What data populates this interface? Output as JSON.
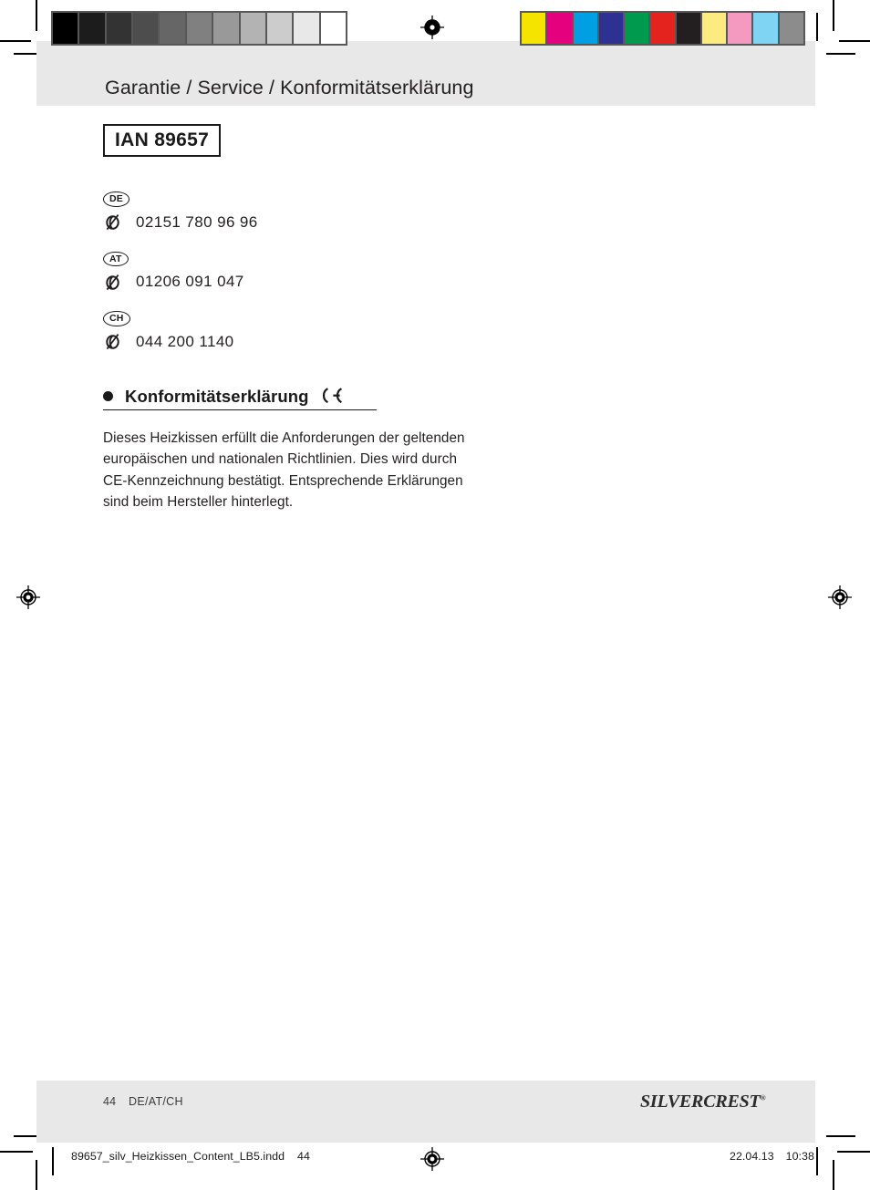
{
  "document": {
    "header_title": "Garantie / Service / Konformitätserklärung",
    "ian_label": "IAN 89657"
  },
  "service": {
    "entries": [
      {
        "country_code": "DE",
        "phone": "02151 780 96 96",
        "phone_icon": "phone-icon"
      },
      {
        "country_code": "AT",
        "phone": "01206 091 047",
        "phone_icon": "phone-icon"
      },
      {
        "country_code": "CH",
        "phone": "044 200 1140",
        "phone_icon": "phone-icon"
      }
    ]
  },
  "conformity": {
    "bullet_icon": "bullet-dot-icon",
    "heading": "Konformitätserklärung",
    "ce_icon": "ce-mark-icon",
    "body": "Dieses Heizkissen erfüllt die Anforderungen der geltenden europäischen und nationalen Richtlinien. Dies wird durch CE-Kennzeichnung bestätigt. Entsprechende Erklärungen sind beim Hersteller hinterlegt."
  },
  "footer": {
    "page_number": "44",
    "locales": "DE/AT/CH",
    "brand_silver": "SILVER",
    "brand_crest": "CREST",
    "brand_registered": "®"
  },
  "print_slug": {
    "filename": "89657_silv_Heizkissen_Content_LB5.indd",
    "page": "44",
    "date": "22.04.13",
    "time": "10:38"
  },
  "calibration": {
    "gray_wedge_label": "grayscale-step-wedge",
    "gray_steps": [
      "#000000",
      "#1c1c1c",
      "#333333",
      "#4d4d4d",
      "#666666",
      "#808080",
      "#999999",
      "#b3b3b3",
      "#cccccc",
      "#e8e8e8",
      "#ffffff"
    ],
    "color_bar_label": "color-control-bar",
    "color_steps": [
      "#f5e400",
      "#e5007e",
      "#009fe3",
      "#2e3192",
      "#009a4e",
      "#e4231f",
      "#231f20",
      "#fbeb80",
      "#f49ac1",
      "#7fd4f4",
      "#8c8c8c"
    ]
  },
  "marks": {
    "registration_target_label": "registration-target",
    "crop_mark_label": "crop-mark"
  }
}
